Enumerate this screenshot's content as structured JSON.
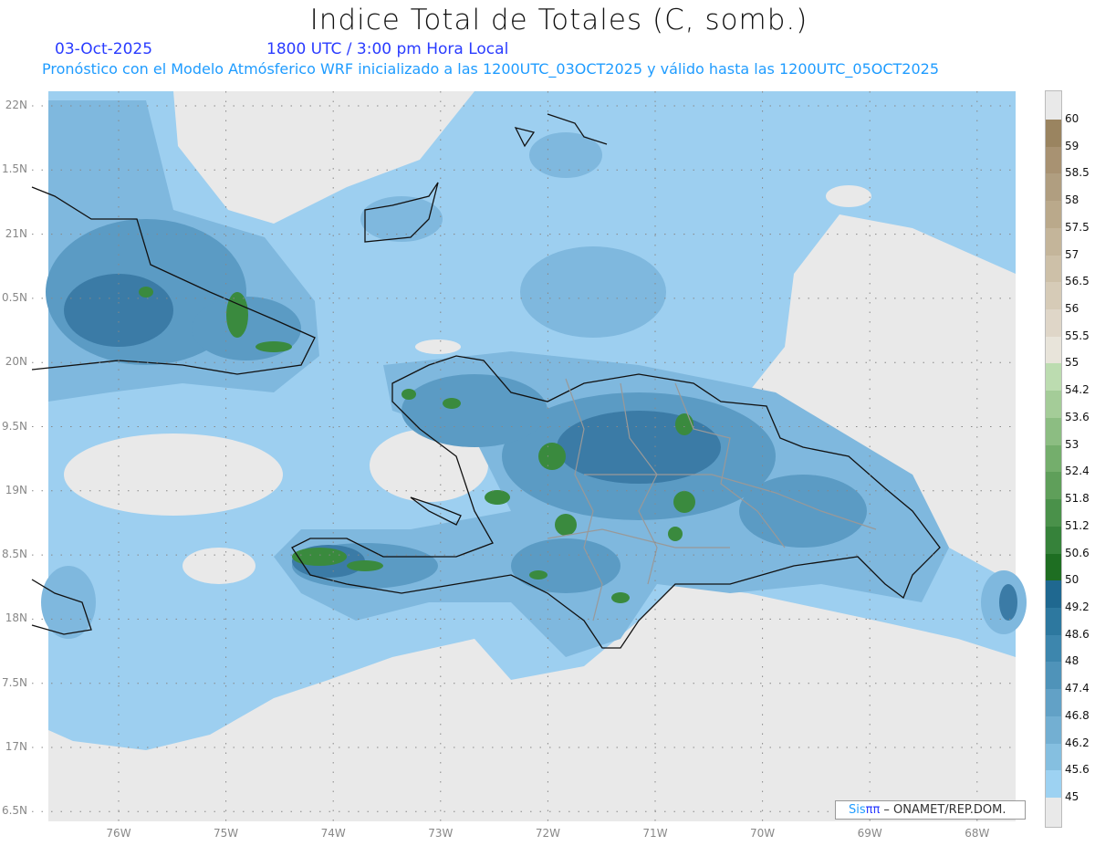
{
  "header": {
    "title": "Indice Total de Totales (C, somb.)",
    "date": "03-Oct-2025",
    "time": "1800 UTC / 3:00 pm Hora Local",
    "subtitle": "Pronóstico con el Modelo Atmósferico WRF inicializado a las 1200UTC_03OCT2025 y válido hasta las  1200UTC_05OCT2025"
  },
  "axes": {
    "lat_labels": [
      "22N",
      "1.5N",
      "21N",
      "0.5N",
      "20N",
      "9.5N",
      "19N",
      "8.5N",
      "18N",
      "7.5N",
      "17N",
      "6.5N"
    ],
    "lon_labels": [
      "76W",
      "75W",
      "74W",
      "73W",
      "72W",
      "71W",
      "70W",
      "69W",
      "68W"
    ]
  },
  "colorbar": {
    "labels": [
      "60",
      "59",
      "58.5",
      "58",
      "57.5",
      "57",
      "56.5",
      "56",
      "55.5",
      "55",
      "54.2",
      "53.6",
      "53",
      "52.4",
      "51.8",
      "51.2",
      "50.6",
      "50",
      "49.2",
      "48.6",
      "48",
      "47.4",
      "46.8",
      "46.2",
      "45.6",
      "45"
    ],
    "colors": [
      "#9a8460",
      "#a89272",
      "#b09e80",
      "#baa98b",
      "#c4b59a",
      "#cdc0a8",
      "#d6cbb7",
      "#dfd6c8",
      "#e8e4da",
      "#bcdcb0",
      "#a4cc98",
      "#8cbd82",
      "#74ae6c",
      "#5f9f5a",
      "#4a914a",
      "#36823a",
      "#1e6e22",
      "#1f6890",
      "#2d789f",
      "#3d86ad",
      "#4f93b9",
      "#62a1c6",
      "#73afd2",
      "#85bfe0",
      "#9dd2f2"
    ]
  },
  "credit": {
    "sis": "Sis",
    "pi": "ππ",
    "text": " – ONAMET/REP.DOM."
  },
  "map_colors": {
    "background": "#e9e9e9",
    "light": "#9dcff0",
    "mid": "#7fb8de",
    "dark": "#5b9bc4",
    "darker": "#3b7ba6",
    "green": "#3a8a3e"
  }
}
